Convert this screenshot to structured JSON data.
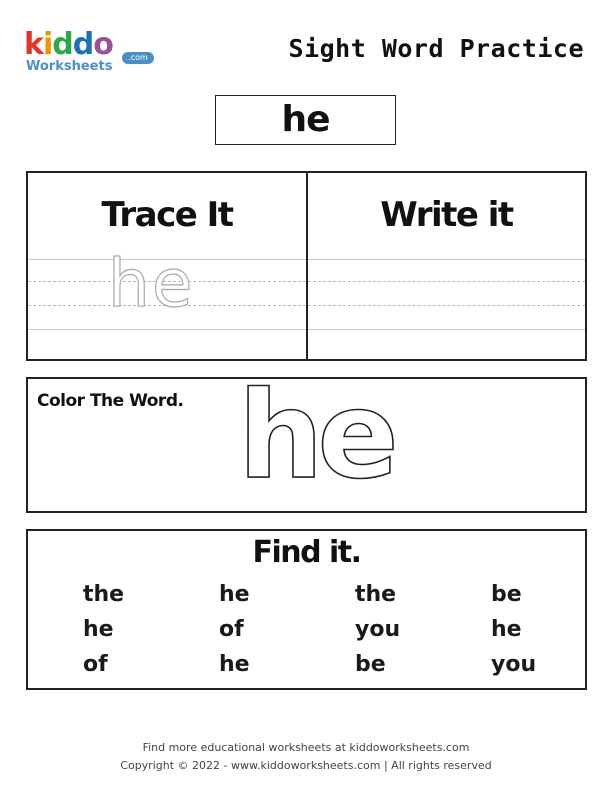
{
  "logo": {
    "brand_letters": [
      {
        "char": "k",
        "color": "#e6332a"
      },
      {
        "char": "i",
        "color": "#f39200"
      },
      {
        "char": "d",
        "color": "#2aa84a"
      },
      {
        "char": "d",
        "color": "#1d71b8"
      },
      {
        "char": "o",
        "color": "#9b4f96"
      }
    ],
    "sub": "Worksheets",
    "com": ".com"
  },
  "title": "Sight Word Practice",
  "sight_word": "he",
  "trace": {
    "heading": "Trace It",
    "word": "he"
  },
  "write": {
    "heading": "Write it"
  },
  "color_section": {
    "label": "Color The Word.",
    "word": "he"
  },
  "find": {
    "heading": "Find it.",
    "rows": [
      [
        "the",
        "he",
        "the",
        "be"
      ],
      [
        "he",
        "of",
        "you",
        "he"
      ],
      [
        "of",
        "he",
        "be",
        "you"
      ]
    ]
  },
  "footer": {
    "line1": "Find more educational worksheets at kiddoworksheets.com",
    "line2": "Copyright © 2022 - www.kiddoworksheets.com  |  All rights reserved"
  }
}
